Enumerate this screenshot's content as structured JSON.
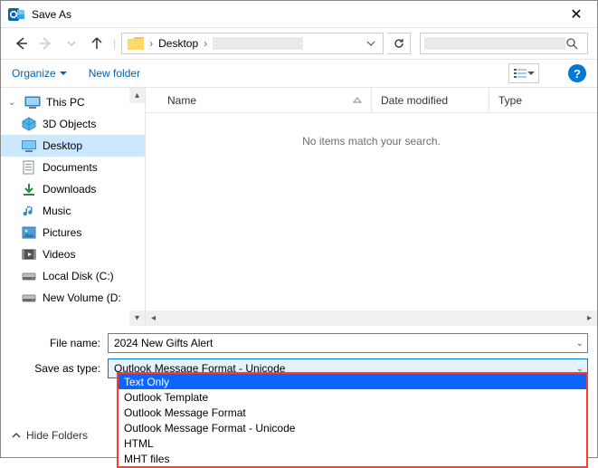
{
  "window": {
    "title": "Save As"
  },
  "nav": {
    "crumb1": "Desktop",
    "search_placeholder": ""
  },
  "toolbar": {
    "organize": "Organize",
    "new_folder": "New folder"
  },
  "tree": {
    "root": "This PC",
    "items": [
      {
        "label": "3D Objects",
        "icon": "cube"
      },
      {
        "label": "Desktop",
        "icon": "desktop",
        "selected": true
      },
      {
        "label": "Documents",
        "icon": "docs"
      },
      {
        "label": "Downloads",
        "icon": "downloads"
      },
      {
        "label": "Music",
        "icon": "music"
      },
      {
        "label": "Pictures",
        "icon": "pictures"
      },
      {
        "label": "Videos",
        "icon": "videos"
      },
      {
        "label": "Local Disk (C:)",
        "icon": "drive"
      },
      {
        "label": "New Volume (D:",
        "icon": "drive"
      }
    ]
  },
  "columns": {
    "name": "Name",
    "date": "Date modified",
    "type": "Type"
  },
  "content": {
    "empty": "No items match your search."
  },
  "form": {
    "filename_label": "File name:",
    "filename_value": "2024 New Gifts Alert",
    "type_label": "Save as type:",
    "type_value": "Outlook Message Format - Unicode"
  },
  "dropdown_options": [
    "Text Only",
    "Outlook Template",
    "Outlook Message Format",
    "Outlook Message Format - Unicode",
    "HTML",
    "MHT files"
  ],
  "dropdown_selected_index": 0,
  "footer": {
    "hide_folders": "Hide Folders"
  }
}
